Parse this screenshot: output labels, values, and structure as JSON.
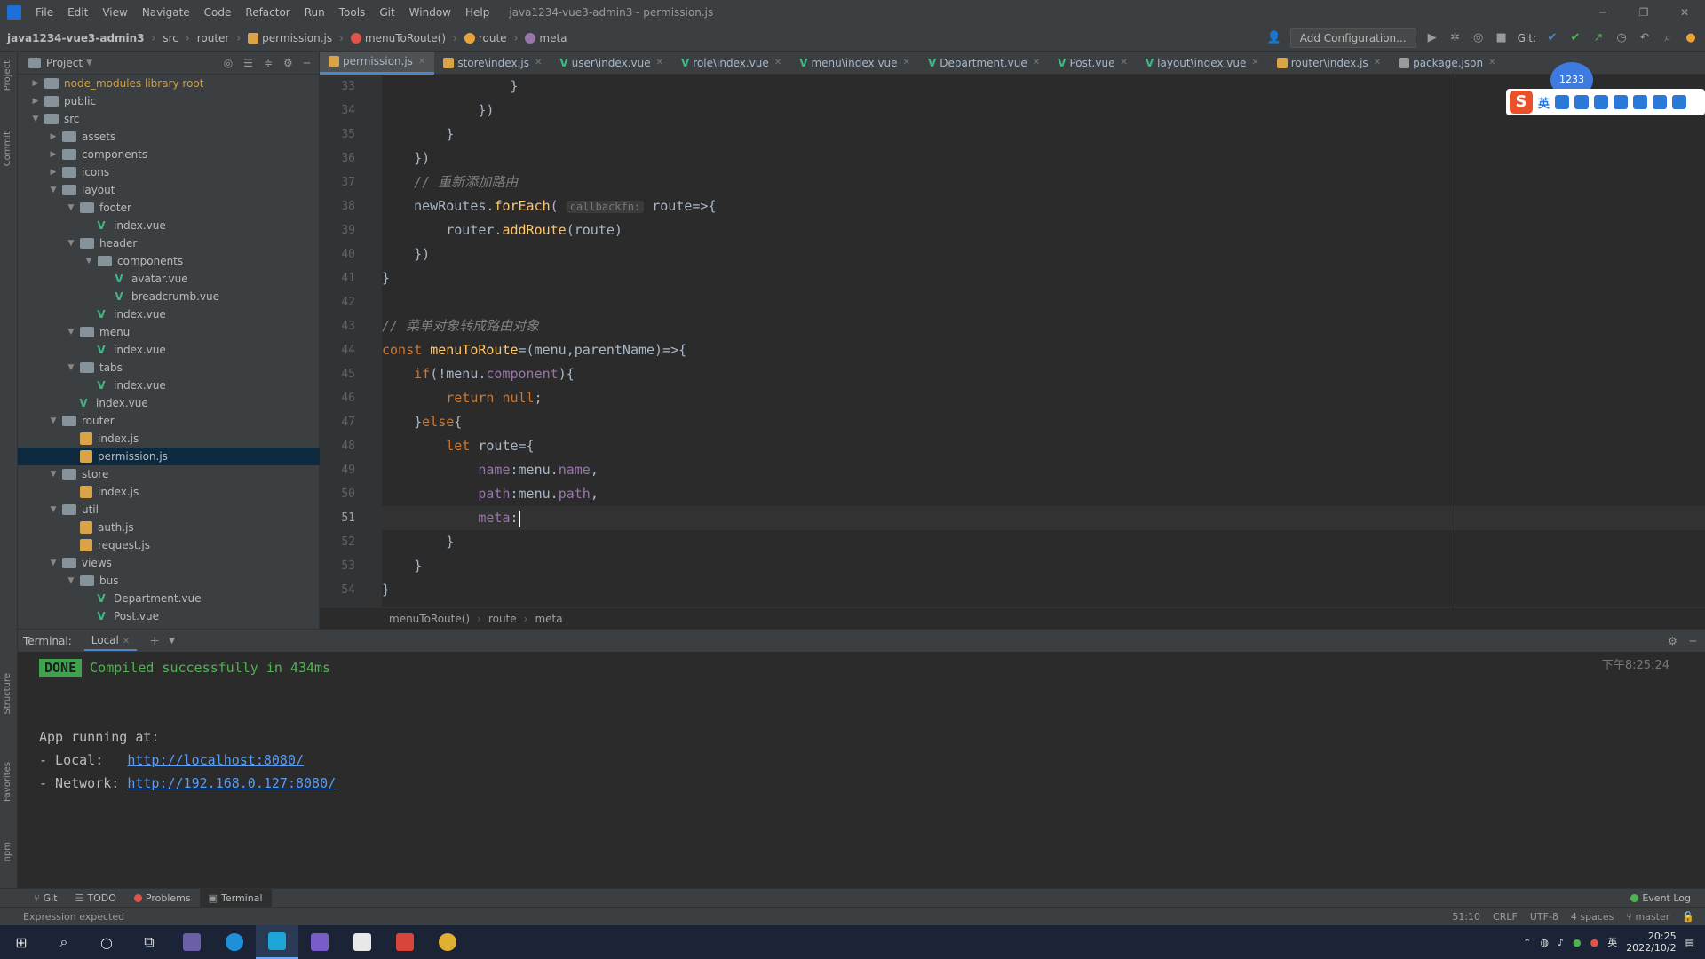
{
  "menubar": {
    "items": [
      "File",
      "Edit",
      "View",
      "Navigate",
      "Code",
      "Refactor",
      "Run",
      "Tools",
      "Git",
      "Window",
      "Help"
    ],
    "title": "java1234-vue3-admin3 - permission.js"
  },
  "navbar": {
    "breadcrumbs": [
      "java1234-vue3-admin3",
      "src",
      "router",
      "permission.js",
      "menuToRoute()",
      "route",
      "meta"
    ],
    "add_config": "Add Configuration...",
    "git_label": "Git:"
  },
  "project": {
    "title": "Project",
    "tree": [
      {
        "label": "node_modules  library root",
        "type": "folder",
        "depth": 0,
        "expanded": false,
        "excluded": true
      },
      {
        "label": "public",
        "type": "folder",
        "depth": 0,
        "expanded": false
      },
      {
        "label": "src",
        "type": "folder",
        "depth": 0,
        "expanded": true
      },
      {
        "label": "assets",
        "type": "folder",
        "depth": 1,
        "expanded": false
      },
      {
        "label": "components",
        "type": "folder",
        "depth": 1,
        "expanded": false
      },
      {
        "label": "icons",
        "type": "folder",
        "depth": 1,
        "expanded": false
      },
      {
        "label": "layout",
        "type": "folder",
        "depth": 1,
        "expanded": true
      },
      {
        "label": "footer",
        "type": "folder",
        "depth": 2,
        "expanded": true
      },
      {
        "label": "index.vue",
        "type": "vue",
        "depth": 3
      },
      {
        "label": "header",
        "type": "folder",
        "depth": 2,
        "expanded": true
      },
      {
        "label": "components",
        "type": "folder",
        "depth": 3,
        "expanded": true
      },
      {
        "label": "avatar.vue",
        "type": "vue",
        "depth": 4
      },
      {
        "label": "breadcrumb.vue",
        "type": "vue",
        "depth": 4
      },
      {
        "label": "index.vue",
        "type": "vue",
        "depth": 3
      },
      {
        "label": "menu",
        "type": "folder",
        "depth": 2,
        "expanded": true
      },
      {
        "label": "index.vue",
        "type": "vue",
        "depth": 3
      },
      {
        "label": "tabs",
        "type": "folder",
        "depth": 2,
        "expanded": true
      },
      {
        "label": "index.vue",
        "type": "vue",
        "depth": 3
      },
      {
        "label": "index.vue",
        "type": "vue",
        "depth": 2
      },
      {
        "label": "router",
        "type": "folder",
        "depth": 1,
        "expanded": true
      },
      {
        "label": "index.js",
        "type": "js",
        "depth": 2
      },
      {
        "label": "permission.js",
        "type": "js",
        "depth": 2,
        "selected": true
      },
      {
        "label": "store",
        "type": "folder",
        "depth": 1,
        "expanded": true
      },
      {
        "label": "index.js",
        "type": "js",
        "depth": 2
      },
      {
        "label": "util",
        "type": "folder",
        "depth": 1,
        "expanded": true
      },
      {
        "label": "auth.js",
        "type": "js",
        "depth": 2
      },
      {
        "label": "request.js",
        "type": "js",
        "depth": 2
      },
      {
        "label": "views",
        "type": "folder",
        "depth": 1,
        "expanded": true
      },
      {
        "label": "bus",
        "type": "folder",
        "depth": 2,
        "expanded": true
      },
      {
        "label": "Department.vue",
        "type": "vue",
        "depth": 3
      },
      {
        "label": "Post.vue",
        "type": "vue",
        "depth": 3
      }
    ]
  },
  "tabs": [
    {
      "label": "permission.js",
      "type": "js",
      "active": true
    },
    {
      "label": "store\\index.js",
      "type": "js"
    },
    {
      "label": "user\\index.vue",
      "type": "vue"
    },
    {
      "label": "role\\index.vue",
      "type": "vue"
    },
    {
      "label": "menu\\index.vue",
      "type": "vue"
    },
    {
      "label": "Department.vue",
      "type": "vue"
    },
    {
      "label": "Post.vue",
      "type": "vue"
    },
    {
      "label": "layout\\index.vue",
      "type": "vue"
    },
    {
      "label": "router\\index.js",
      "type": "js"
    },
    {
      "label": "package.json",
      "type": "json"
    }
  ],
  "editor": {
    "current_line": "51",
    "lines": [
      {
        "n": "33",
        "html": "                }"
      },
      {
        "n": "34",
        "html": "            })"
      },
      {
        "n": "35",
        "html": "        }"
      },
      {
        "n": "36",
        "html": "    })"
      },
      {
        "n": "37",
        "html": "    <span class=\"cm\">// 重新添加路由</span>"
      },
      {
        "n": "38",
        "html": "    newRoutes.<span class=\"fn\">forEach</span>( <span class=\"hint\">callbackfn:</span> route=>{"
      },
      {
        "n": "39",
        "html": "        router.<span class=\"fn\">addRoute</span>(route)"
      },
      {
        "n": "40",
        "html": "    })"
      },
      {
        "n": "41",
        "html": "}"
      },
      {
        "n": "42",
        "html": ""
      },
      {
        "n": "43",
        "html": "<span class=\"cm\">// 菜单对象转成路由对象</span>"
      },
      {
        "n": "44",
        "html": "<span class=\"kw\">const</span> <span class=\"fn\">menuToRoute</span>=(menu,parentName)=>{"
      },
      {
        "n": "45",
        "html": "    <span class=\"kw\">if</span>(!menu.<span class=\"prop\">component</span>){"
      },
      {
        "n": "46",
        "html": "        <span class=\"kw\">return null</span>;"
      },
      {
        "n": "47",
        "html": "    }<span class=\"kw\">else</span>{"
      },
      {
        "n": "48",
        "html": "        <span class=\"kw\">let</span> route={"
      },
      {
        "n": "49",
        "html": "            <span class=\"prop\">name</span>:menu.<span class=\"prop\">name</span>,"
      },
      {
        "n": "50",
        "html": "            <span class=\"prop\">path</span>:menu.<span class=\"prop\">path</span>,"
      },
      {
        "n": "51",
        "html": "            <span class=\"prop\">meta</span>:<span class=\"caret\"></span>"
      },
      {
        "n": "52",
        "html": "        }"
      },
      {
        "n": "53",
        "html": "    }"
      },
      {
        "n": "54",
        "html": "}"
      }
    ]
  },
  "editor_breadcrumb": [
    "menuToRoute()",
    "route",
    "meta"
  ],
  "terminal": {
    "title": "Terminal:",
    "tab": "Local",
    "done": "DONE",
    "compiled": "Compiled successfully in 434ms",
    "time": "下午8:25:24",
    "running": "App running at:",
    "local_label": "- Local:   ",
    "local_url": "http://localhost:8080/",
    "network_label": "- Network: ",
    "network_url": "http://192.168.0.127:8080/"
  },
  "tooltabs": [
    "Git",
    "TODO",
    "Problems",
    "Terminal"
  ],
  "event_log": "Event Log",
  "status": {
    "message": "Expression expected",
    "position": "51:10",
    "line_sep": "CRLF",
    "encoding": "UTF-8",
    "indent": "4 spaces",
    "branch": "master"
  },
  "taskbar": {
    "clock_time": "20:25",
    "clock_date": "2022/10/2",
    "tray_lang": "英"
  },
  "ime": {
    "badge": "1233",
    "logo": "S",
    "lang": "英"
  },
  "colors": {
    "accent": "#4a88c7",
    "vue": "#41b883",
    "keyword": "#cc7832",
    "function": "#ffc66d",
    "success": "#3fa34d"
  }
}
